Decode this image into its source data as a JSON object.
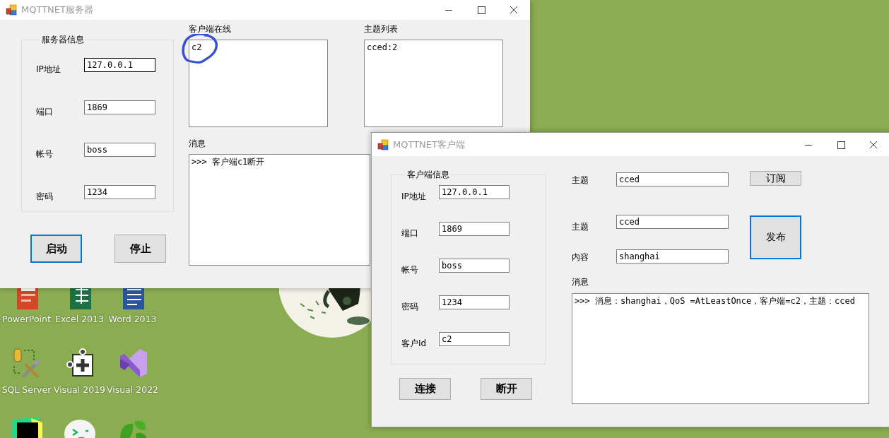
{
  "server_window": {
    "title": "MQTTNET服务器",
    "info_group": {
      "title": "服务器信息",
      "fields": [
        {
          "label": "IP地址",
          "value": "127.0.0.1",
          "focused": true
        },
        {
          "label": "端口",
          "value": "1869",
          "focused": false
        },
        {
          "label": "帐号",
          "value": "boss",
          "focused": false
        },
        {
          "label": "密码",
          "value": "1234",
          "focused": false
        }
      ]
    },
    "buttons": [
      {
        "label": "启动",
        "focused": true
      },
      {
        "label": "停止",
        "focused": false
      }
    ],
    "online_clients": {
      "label": "客户端在线",
      "items": [
        "c2"
      ]
    },
    "topics": {
      "label": "主题列表",
      "items": [
        "cced:2"
      ]
    },
    "messages": {
      "label": "消息",
      "lines": [
        ">>> 客户端c1断开"
      ]
    }
  },
  "client_window": {
    "title": "MQTTNET客户端",
    "info_group": {
      "title": "客户端信息",
      "fields": [
        {
          "label": "IP地址",
          "value": "127.0.0.1",
          "focused": false
        },
        {
          "label": "端口",
          "value": "1869",
          "focused": false
        },
        {
          "label": "帐号",
          "value": "boss",
          "focused": false
        },
        {
          "label": "密码",
          "value": "1234",
          "focused": false
        },
        {
          "label": "客户Id",
          "value": "c2",
          "focused": false
        }
      ]
    },
    "buttons": [
      {
        "label": "连接",
        "focused": false
      },
      {
        "label": "断开",
        "focused": false
      }
    ],
    "subscribe": {
      "field": {
        "label": "主题",
        "value": "cced",
        "focused": false
      },
      "button": {
        "label": "订阅",
        "focused": false
      }
    },
    "publish": {
      "fields": [
        {
          "label": "主题",
          "value": "cced",
          "focused": false
        },
        {
          "label": "内容",
          "value": "shanghai",
          "focused": false
        }
      ],
      "button": {
        "label": "发布",
        "focused": true
      }
    },
    "messages": {
      "label": "消息",
      "lines": [
        ">>> 消息：shanghai，QoS =AtLeastOnce，客户端=c2，主题：cced"
      ]
    }
  },
  "desktop_icons": [
    {
      "label": "PowerPoint"
    },
    {
      "label": "Excel 2013"
    },
    {
      "label": "Word 2013"
    },
    {
      "label": "SQL Server"
    },
    {
      "label": "Visual 2019"
    },
    {
      "label": "Visual 2022"
    }
  ]
}
